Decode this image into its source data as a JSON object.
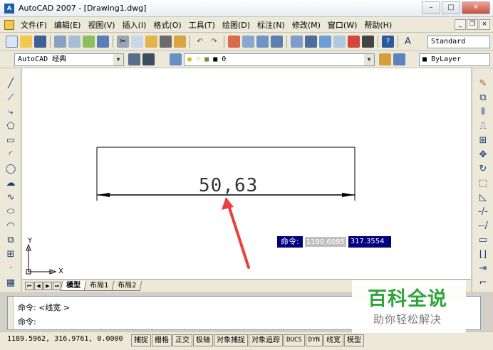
{
  "window": {
    "title": "AutoCAD 2007 - [Drawing1.dwg]",
    "app_icon": "autocad-icon"
  },
  "menu": {
    "items": [
      "文件(F)",
      "编辑(E)",
      "视图(V)",
      "插入(I)",
      "格式(O)",
      "工具(T)",
      "绘图(D)",
      "标注(N)",
      "修改(M)",
      "窗口(W)",
      "帮助(H)"
    ],
    "mdi_buttons": [
      "_",
      "❐",
      "×"
    ]
  },
  "toolbar": {
    "text_style": "Standard"
  },
  "workspace": {
    "name": "AutoCAD 经典"
  },
  "layers": {
    "current": "0"
  },
  "properties": {
    "color": "ByLayer"
  },
  "drawing": {
    "dimension_value": "50,63",
    "annotation_arrow_color": "#e8413c"
  },
  "dynamic_input": {
    "label": "命令:",
    "x_value": "1190.6095",
    "y_value": "317.3554"
  },
  "ucs": {
    "x_label": "X",
    "y_label": "Y"
  },
  "layout_tabs": {
    "items": [
      "模型",
      "布局1",
      "布局2"
    ],
    "active": "模型"
  },
  "command_window": {
    "history_line": "命令:  <线宽 >",
    "prompt_line": "命令:"
  },
  "status_bar": {
    "coordinates": "1189.5962, 316.9761, 0.0000",
    "toggles": [
      "捕捉",
      "栅格",
      "正交",
      "极轴",
      "对象捕捉",
      "对象追踪",
      "DUCS",
      "DYN",
      "线宽",
      "模型"
    ]
  },
  "watermark": {
    "title": "百科全说",
    "subtitle": "助你轻松解决"
  }
}
